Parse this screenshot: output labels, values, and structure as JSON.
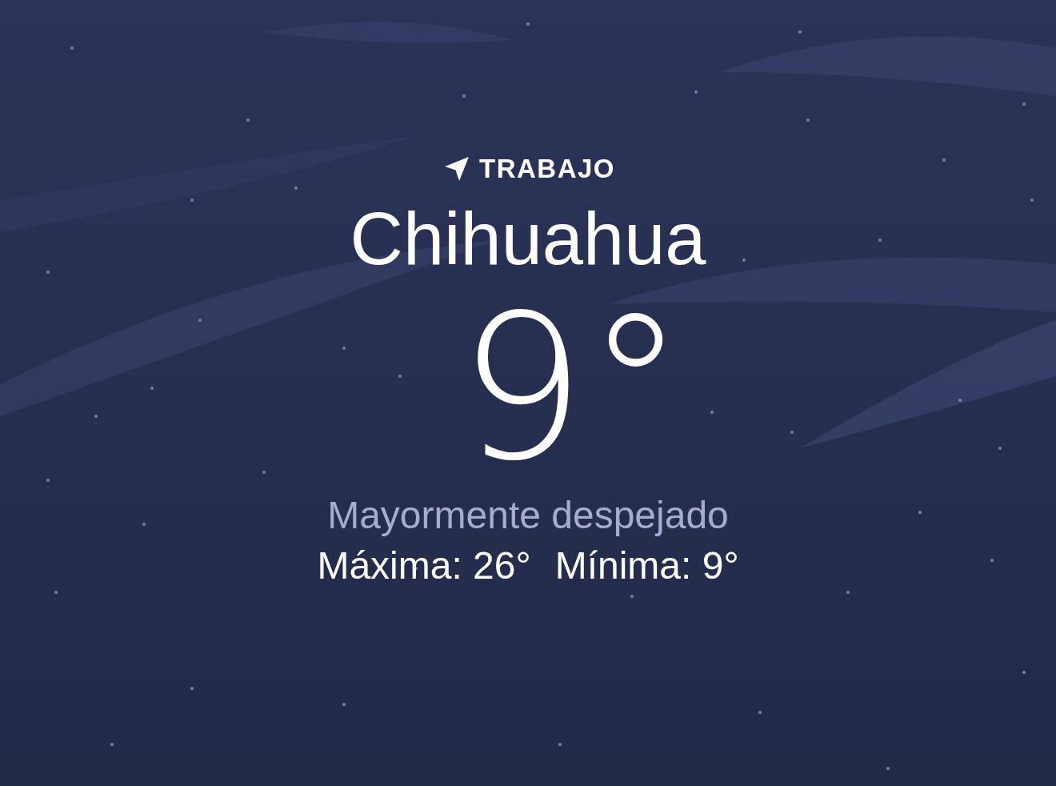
{
  "location_label": "TRABAJO",
  "city": "Chihuahua",
  "temperature": "9°",
  "condition": "Mayormente despejado",
  "high": "Máxima: 26°",
  "low": "Mínima: 9°"
}
